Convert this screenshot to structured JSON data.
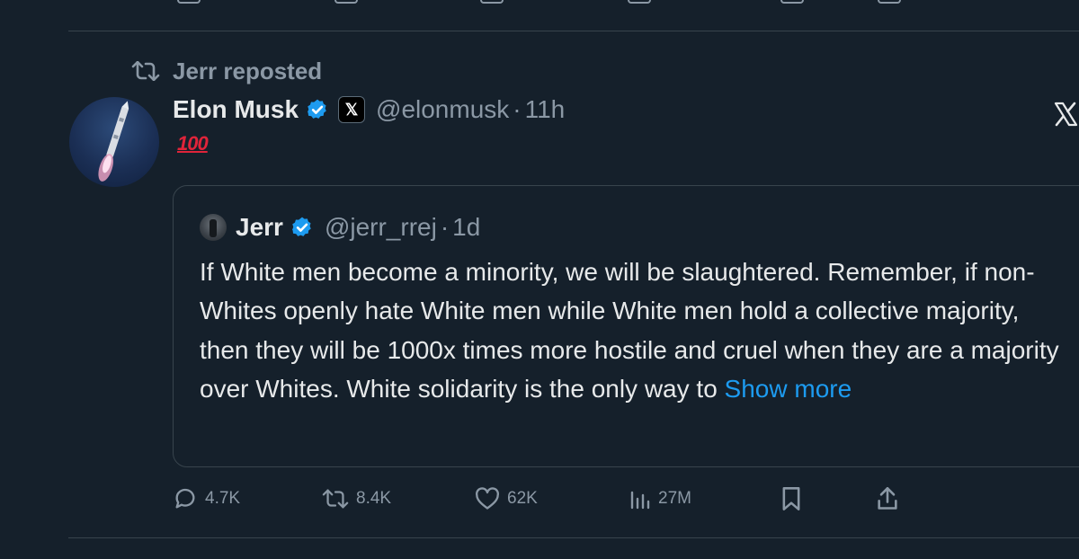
{
  "repost": {
    "label": "Jerr reposted",
    "icon": "repost-icon"
  },
  "post": {
    "author_name": "Elon Musk",
    "handle": "@elonmusk",
    "separator": "·",
    "time": "11h",
    "body_emoji": "💯",
    "body_emoji_text": "100"
  },
  "quote": {
    "author_name": "Jerr",
    "handle": "@jerr_rrej",
    "separator": "·",
    "time": "1d",
    "text": "If White men become a minority, we will be slaughtered. Remember, if non-Whites openly hate White men while White men hold a collective majority, then they will be 1000x times more hostile and cruel when they are a majority over Whites. White solidarity is the only way to ",
    "show_more": "Show more"
  },
  "actions": {
    "replies": "4.7K",
    "reposts": "8.4K",
    "likes": "62K",
    "views": "27M"
  },
  "colors": {
    "background": "#15202b",
    "text": "#e7e9ea",
    "muted": "#8b98a5",
    "accent": "#1d9bf0",
    "verified": "#1d9bf0",
    "emoji_red": "#e0243a"
  }
}
